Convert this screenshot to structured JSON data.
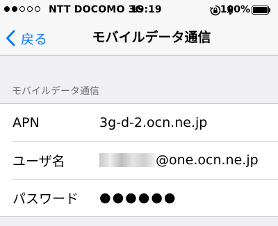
{
  "status_bar": {
    "signal_dots": [
      1,
      1,
      0,
      0,
      0
    ],
    "carrier": "NTT DOCOMO  3G",
    "time": "19:19",
    "battery_text": "100%",
    "icons": [
      "rotation-lock-icon",
      "bluetooth-icon",
      "battery-icon"
    ]
  },
  "nav": {
    "back_label": "戻る",
    "title": "モバイルデータ通信"
  },
  "section": {
    "header": "モバイルデータ通信",
    "rows": [
      {
        "label": "APN",
        "value": "3g-d-2.ocn.ne.jp"
      },
      {
        "label": "ユーザ名",
        "value": "@one.ocn.ne.jp"
      },
      {
        "label": "パスワード",
        "value": "●●●●●●"
      }
    ]
  },
  "colors": {
    "accent": "#0a7aff",
    "background": "#efeff4",
    "separator": "#c8c7cc",
    "section_header": "#6d6d72"
  }
}
